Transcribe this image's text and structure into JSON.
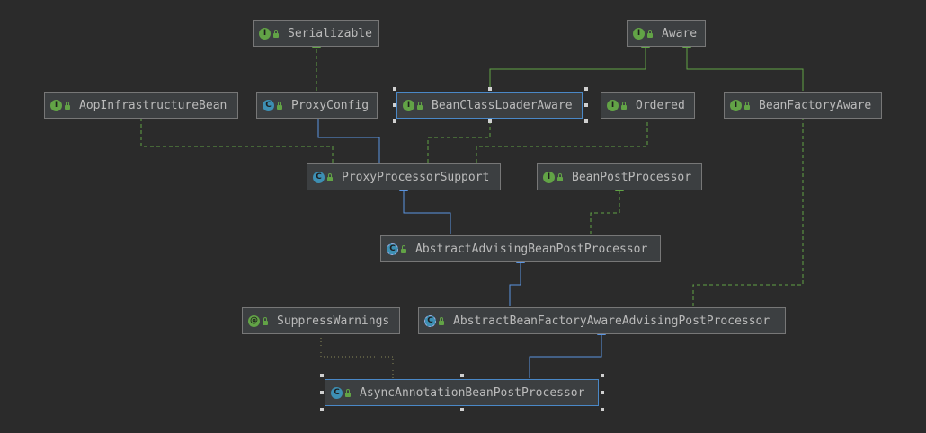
{
  "nodes": {
    "serializable": {
      "label": "Serializable",
      "kind": "interface"
    },
    "aware": {
      "label": "Aware",
      "kind": "interface"
    },
    "aop_infrastructure_bean": {
      "label": "AopInfrastructureBean",
      "kind": "interface"
    },
    "proxy_config": {
      "label": "ProxyConfig",
      "kind": "class"
    },
    "bean_class_loader_aware": {
      "label": "BeanClassLoaderAware",
      "kind": "interface"
    },
    "ordered": {
      "label": "Ordered",
      "kind": "interface"
    },
    "bean_factory_aware": {
      "label": "BeanFactoryAware",
      "kind": "interface"
    },
    "proxy_processor_support": {
      "label": "ProxyProcessorSupport",
      "kind": "class"
    },
    "bean_post_processor": {
      "label": "BeanPostProcessor",
      "kind": "interface"
    },
    "abstract_advising_bean_post_processor": {
      "label": "AbstractAdvisingBeanPostProcessor",
      "kind": "abstract"
    },
    "suppress_warnings": {
      "label": "SuppressWarnings",
      "kind": "annotation"
    },
    "abstract_bean_factory_aware_advising_post_processor": {
      "label": "AbstractBeanFactoryAwareAdvisingPostProcessor",
      "kind": "abstract"
    },
    "async_annotation_bean_post_processor": {
      "label": "AsyncAnnotationBeanPostProcessor",
      "kind": "class"
    }
  },
  "colors": {
    "background": "#2b2b2b",
    "node_fill": "#3c3f41",
    "node_border": "#777777",
    "extends_edge": "#5b94e0",
    "implements_edge": "#62a346",
    "annotation_edge": "#8a8a5a",
    "selection": "#4a88c7"
  },
  "badge_glyphs": {
    "interface": "I",
    "class": "C",
    "abstract": "C",
    "annotation": "@"
  }
}
